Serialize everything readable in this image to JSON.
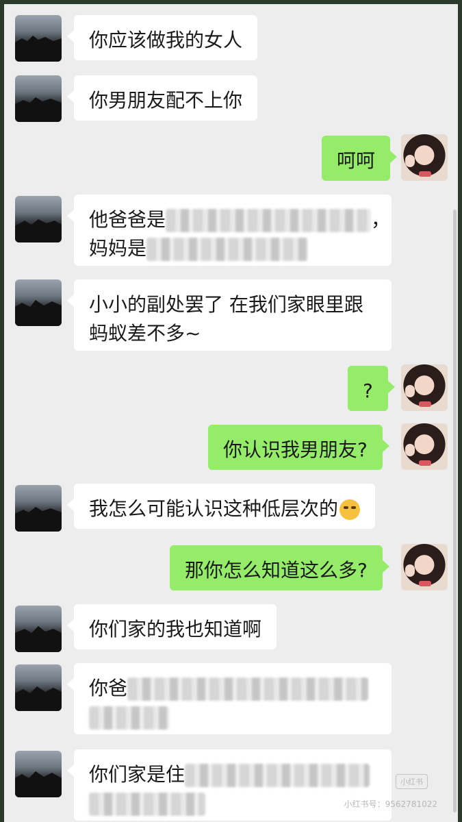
{
  "conversation": {
    "messages": [
      {
        "side": "left",
        "text": "你应该做我的女人"
      },
      {
        "side": "left",
        "text": "你男朋友配不上你"
      },
      {
        "side": "right",
        "text": "呵呵"
      },
      {
        "side": "left",
        "line1_visible": "他爸爸是",
        "line1_end": "，",
        "line2_visible": "妈妈是"
      },
      {
        "side": "left",
        "line1": "小小的副处罢了 在我们家眼里跟",
        "line2": "蚂蚁差不多~"
      },
      {
        "side": "right",
        "text": "?"
      },
      {
        "side": "right",
        "text": "你认识我男朋友?"
      },
      {
        "side": "left",
        "text": "我怎么可能认识这种低层次的",
        "emoji": "sly-face-emoji"
      },
      {
        "side": "right",
        "text": "那你怎么知道这么多?"
      },
      {
        "side": "left",
        "text": "你们家的我也知道啊"
      },
      {
        "side": "left",
        "line1_visible": "你爸"
      },
      {
        "side": "left",
        "line1_visible": "你们家是住"
      }
    ]
  },
  "avatars": {
    "left": "dusk-sky-avatar",
    "right": "girl-avatar"
  },
  "colors": {
    "background": "#ededed",
    "sent_bubble": "#95ec69",
    "received_bubble": "#ffffff"
  },
  "watermark": {
    "text": "小红书号：9562781022",
    "logo": "小红书"
  }
}
